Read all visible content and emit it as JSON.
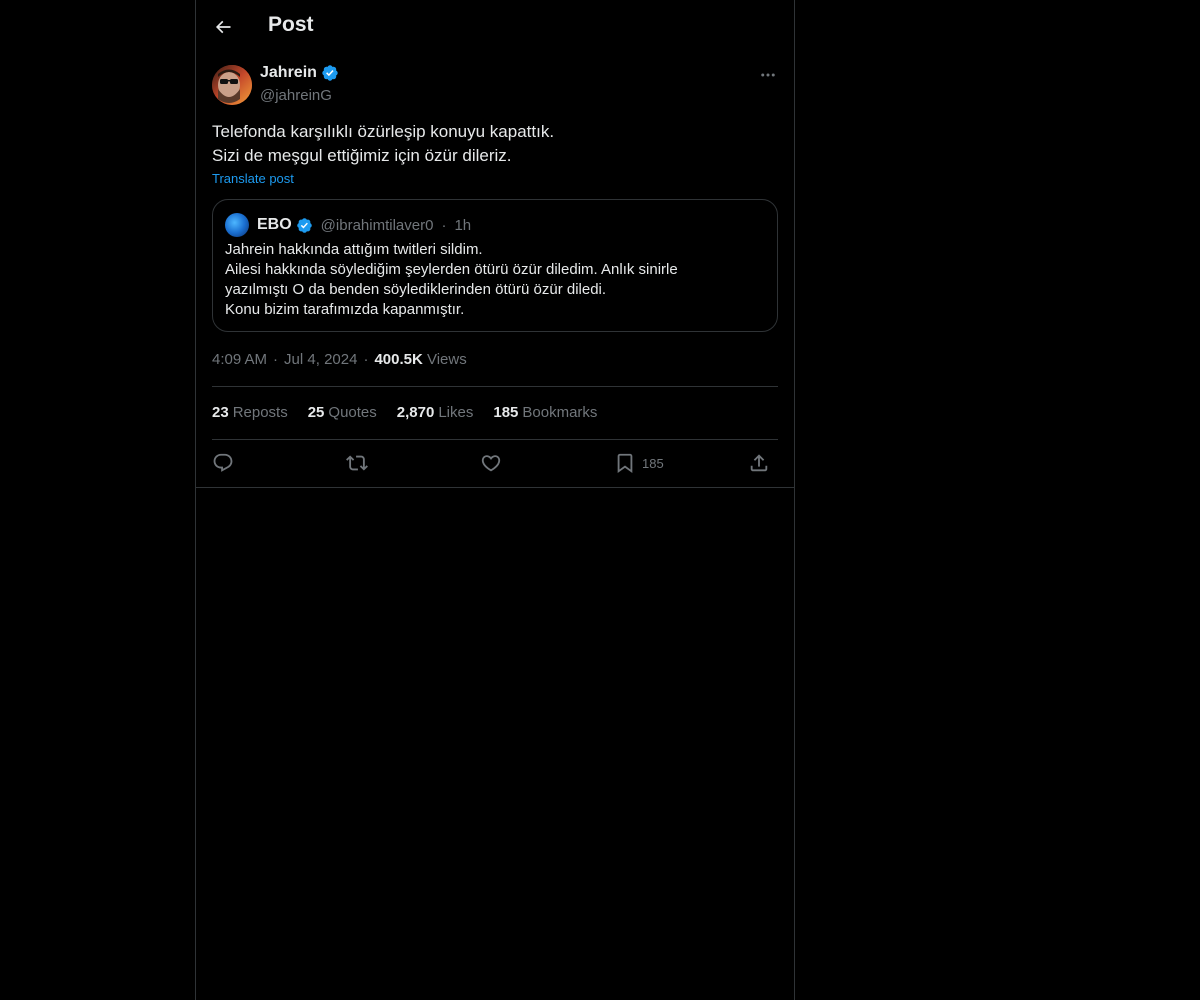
{
  "header": {
    "title": "Post",
    "back_icon": "arrow-left-icon"
  },
  "author": {
    "name": "Jahrein",
    "handle": "@jahreinG",
    "verified": true,
    "verified_color": "#1d9bf0"
  },
  "tweet": {
    "lines": [
      "Telefonda karşılıklı özürleşip konuyu kapattık.",
      "Sizi de meşgul ettiğimiz için özür dileriz."
    ],
    "translate_label": "Translate post"
  },
  "quote": {
    "name": "EBO",
    "verified": true,
    "handle": "@ibrahimtilaver0",
    "separator": "·",
    "time": "1h",
    "lines": [
      "Jahrein hakkında attığım twitleri sildim.",
      "Ailesi hakkında söylediğim şeylerden ötürü özür diledim. Anlık sinirle",
      "yazılmıştı O da benden söylediklerinden ötürü özür diledi.",
      "Konu bizim tarafımızda kapanmıştır."
    ]
  },
  "meta": {
    "time": "4:09 AM",
    "separator": "·",
    "date": "Jul 4, 2024",
    "views_count": "400.5K",
    "views_label": "Views"
  },
  "stats": [
    {
      "count": "23",
      "label": "Reposts"
    },
    {
      "count": "25",
      "label": "Quotes"
    },
    {
      "count": "2,870",
      "label": "Likes"
    },
    {
      "count": "185",
      "label": "Bookmarks"
    }
  ],
  "actions": {
    "reply_icon": "reply-icon",
    "repost_icon": "repost-icon",
    "like_icon": "heart-icon",
    "bookmark_icon": "bookmark-icon",
    "bookmark_count": "185",
    "share_icon": "share-icon"
  },
  "colors": {
    "background": "#000000",
    "text_primary": "#e7e9ea",
    "text_secondary": "#71767b",
    "border": "#2f3336",
    "accent": "#1d9bf0"
  }
}
